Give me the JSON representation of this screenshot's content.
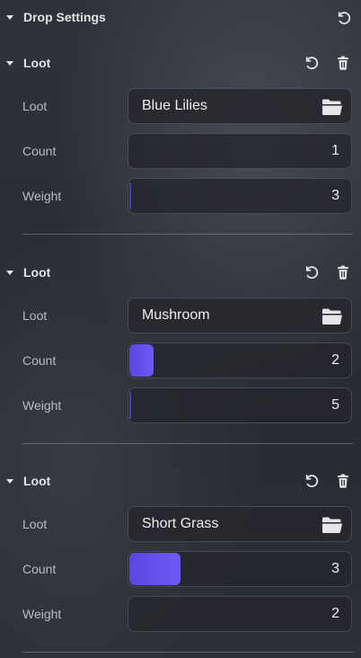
{
  "header": {
    "title": "Drop Settings"
  },
  "loot_entries": [
    {
      "title": "Loot",
      "loot_label": "Loot",
      "loot_value": "Blue Lilies",
      "count_label": "Count",
      "count_value": "1",
      "count_fill_fraction": 0.0,
      "weight_label": "Weight",
      "weight_value": "3",
      "weight_fill_fraction": 0.005
    },
    {
      "title": "Loot",
      "loot_label": "Loot",
      "loot_value": "Mushroom",
      "count_label": "Count",
      "count_value": "2",
      "count_fill_fraction": 0.11,
      "weight_label": "Weight",
      "weight_value": "5",
      "weight_fill_fraction": 0.008
    },
    {
      "title": "Loot",
      "loot_label": "Loot",
      "loot_value": "Short Grass",
      "count_label": "Count",
      "count_value": "3",
      "count_fill_fraction": 0.23,
      "weight_label": "Weight",
      "weight_value": "2",
      "weight_fill_fraction": 0.0
    }
  ],
  "colors": {
    "accent": "#6651ec",
    "field_bg": "#25262c",
    "text": "#eceef1",
    "label": "#b9bbc2"
  },
  "icons": {
    "collapse": "triangle-down-icon",
    "reset": "reset-icon",
    "delete": "trash-icon",
    "browse": "folder-icon"
  }
}
